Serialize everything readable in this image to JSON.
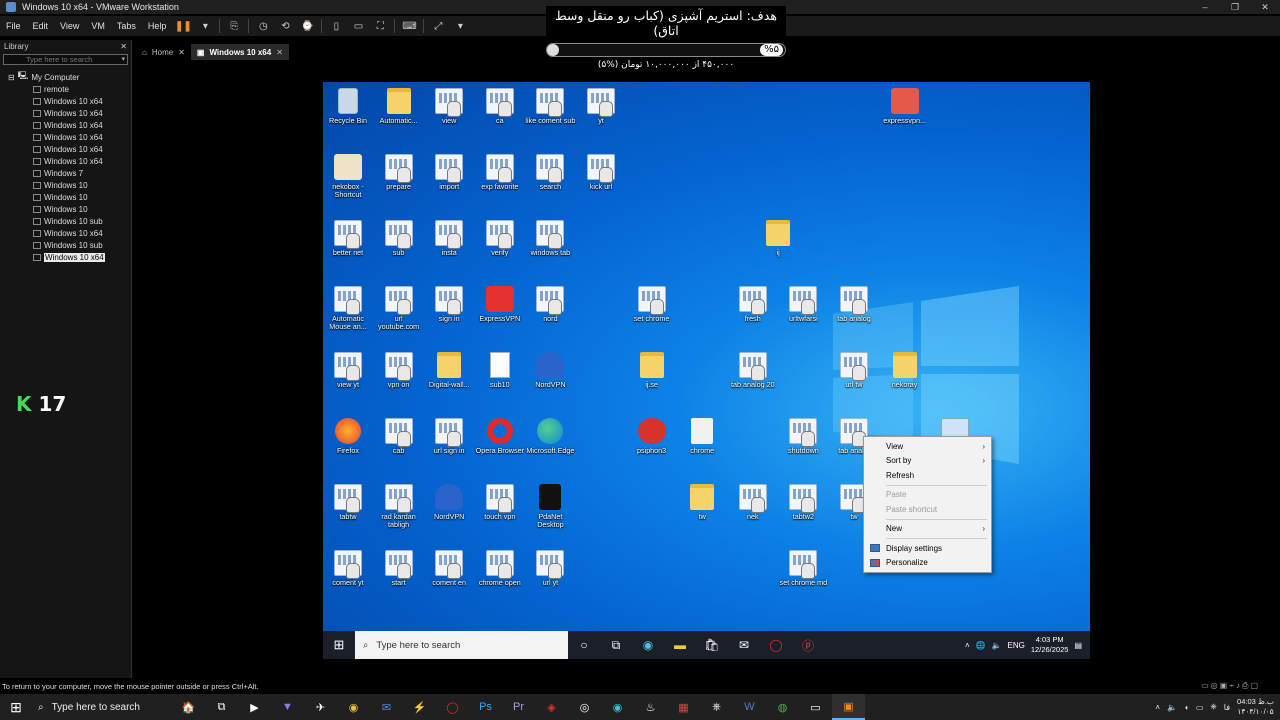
{
  "window": {
    "title": "Windows 10 x64 - VMware Workstation",
    "controls": [
      "–",
      "❐",
      "✕"
    ]
  },
  "menu": {
    "items": [
      "File",
      "Edit",
      "View",
      "VM",
      "Tabs",
      "Help"
    ]
  },
  "library": {
    "title": "Library",
    "close": "✕",
    "search_placeholder": "Type here to search",
    "root_label": "My Computer",
    "items": [
      "remote",
      "Windows 10 x64",
      "Windows 10 x64",
      "Windows 10 x64",
      "Windows 10 x64",
      "Windows 10 x64",
      "Windows 10 x64",
      "Windows 7",
      "Windows 10",
      "Windows 10",
      "Windows 10",
      "Windows 10 sub",
      "Windows 10 x64",
      "Windows 10 sub",
      "Windows 10 x64"
    ],
    "selected_index": 14
  },
  "logo_badge": {
    "letter": "K",
    "number": "17"
  },
  "tabs": [
    {
      "label": "Home",
      "close": "✕"
    },
    {
      "label": "Windows 10 x64",
      "close": "✕"
    }
  ],
  "stream_overlay": {
    "goal_text": "هدف: استریم آشپزی (کباب رو منقل وسط اتاق)",
    "progress_percent": 5,
    "progress_label": "%۵",
    "amount_text": "۴۵۰,۰۰۰ از ۱۰,۰۰۰,۰۰۰ تومان (%۵)"
  },
  "desktop_icons": [
    {
      "label": "Recycle Bin",
      "icon": "recycle-bin-icon"
    },
    {
      "label": "Automatic...",
      "icon": "folder-icon"
    },
    {
      "label": "view",
      "icon": "keyboard-mouse-icon"
    },
    {
      "label": "ca",
      "icon": "keyboard-mouse-icon"
    },
    {
      "label": "like coment sub",
      "icon": "keyboard-mouse-icon"
    },
    {
      "label": "yt",
      "icon": "keyboard-mouse-icon"
    },
    {
      "label": "expressvpn...",
      "icon": "package-icon"
    },
    {
      "label": "nekobox - Shortcut",
      "icon": "nekobox-icon"
    },
    {
      "label": "prepare",
      "icon": "keyboard-mouse-icon"
    },
    {
      "label": "import",
      "icon": "keyboard-mouse-icon"
    },
    {
      "label": "exp favorite",
      "icon": "keyboard-mouse-icon"
    },
    {
      "label": "search",
      "icon": "keyboard-mouse-icon"
    },
    {
      "label": "kick url",
      "icon": "keyboard-mouse-icon"
    },
    {
      "label": "better net",
      "icon": "keyboard-mouse-icon"
    },
    {
      "label": "sub",
      "icon": "keyboard-mouse-icon"
    },
    {
      "label": "insta",
      "icon": "keyboard-mouse-icon"
    },
    {
      "label": "verify",
      "icon": "keyboard-mouse-icon"
    },
    {
      "label": "windows tab",
      "icon": "keyboard-mouse-icon"
    },
    {
      "label": "ij",
      "icon": "folder-icon"
    },
    {
      "label": "Automatic Mouse an...",
      "icon": "keyboard-mouse-icon"
    },
    {
      "label": "url youtube.com",
      "icon": "keyboard-mouse-icon"
    },
    {
      "label": "sign in",
      "icon": "keyboard-mouse-icon"
    },
    {
      "label": "ExpressVPN",
      "icon": "expressvpn-icon"
    },
    {
      "label": "nord",
      "icon": "keyboard-mouse-icon"
    },
    {
      "label": "set chrome",
      "icon": "keyboard-mouse-icon"
    },
    {
      "label": "fresh",
      "icon": "keyboard-mouse-icon"
    },
    {
      "label": "urltwfarsi",
      "icon": "keyboard-mouse-icon"
    },
    {
      "label": "tab analog",
      "icon": "keyboard-mouse-icon"
    },
    {
      "label": "view yt",
      "icon": "keyboard-mouse-icon"
    },
    {
      "label": "vpn on",
      "icon": "keyboard-mouse-icon"
    },
    {
      "label": "Digital-wall...",
      "icon": "image-file-icon"
    },
    {
      "label": "sub10",
      "icon": "document-icon"
    },
    {
      "label": "NordVPN",
      "icon": "nordvpn-icon"
    },
    {
      "label": "ij.se",
      "icon": "image-file-icon"
    },
    {
      "label": "tab analog 20",
      "icon": "keyboard-mouse-icon"
    },
    {
      "label": "url tw",
      "icon": "keyboard-mouse-icon"
    },
    {
      "label": "nekoray",
      "icon": "folder-icon"
    },
    {
      "label": "Firefox",
      "icon": "firefox-icon"
    },
    {
      "label": "cab",
      "icon": "keyboard-mouse-icon"
    },
    {
      "label": "url sign in",
      "icon": "keyboard-mouse-icon"
    },
    {
      "label": "Opera Browser",
      "icon": "opera-icon"
    },
    {
      "label": "Microsoft Edge",
      "icon": "edge-icon"
    },
    {
      "label": "psiphon3",
      "icon": "psiphon-icon"
    },
    {
      "label": "chrome",
      "icon": "chrome-file-icon"
    },
    {
      "label": "shutdown",
      "icon": "keyboard-mouse-icon"
    },
    {
      "label": "tab anal...",
      "icon": "keyboard-mouse-icon"
    },
    {
      "label": "",
      "icon": "computer-icon"
    },
    {
      "label": "tabtw",
      "icon": "keyboard-mouse-icon"
    },
    {
      "label": "rad kardan tabligh",
      "icon": "keyboard-mouse-icon"
    },
    {
      "label": "NordVPN",
      "icon": "nordvpn-icon"
    },
    {
      "label": "touch vpn",
      "icon": "keyboard-mouse-icon"
    },
    {
      "label": "PdaNet Desktop",
      "icon": "pdanet-icon"
    },
    {
      "label": "tw",
      "icon": "folder-icon"
    },
    {
      "label": "nek",
      "icon": "keyboard-mouse-icon"
    },
    {
      "label": "tabtw2",
      "icon": "keyboard-mouse-icon"
    },
    {
      "label": "tw",
      "icon": "keyboard-mouse-icon"
    },
    {
      "label": "coment yt",
      "icon": "keyboard-mouse-icon"
    },
    {
      "label": "start",
      "icon": "keyboard-mouse-icon"
    },
    {
      "label": "coment en",
      "icon": "keyboard-mouse-icon"
    },
    {
      "label": "chrome open",
      "icon": "keyboard-mouse-icon"
    },
    {
      "label": "url yt",
      "icon": "keyboard-mouse-icon"
    },
    {
      "label": "set chrome md",
      "icon": "keyboard-mouse-icon"
    }
  ],
  "context_menu": {
    "items": [
      {
        "label": "View",
        "submenu": "›",
        "enabled": true
      },
      {
        "label": "Sort by",
        "submenu": "›",
        "enabled": true
      },
      {
        "label": "Refresh",
        "submenu": "",
        "enabled": true
      },
      {
        "label": "Paste",
        "submenu": "",
        "enabled": false
      },
      {
        "label": "Paste shortcut",
        "submenu": "",
        "enabled": false
      },
      {
        "label": "New",
        "submenu": "›",
        "enabled": true
      },
      {
        "label": "Display settings",
        "submenu": "",
        "enabled": true
      },
      {
        "label": "Personalize",
        "submenu": "",
        "enabled": true
      }
    ]
  },
  "guest_taskbar": {
    "search_placeholder": "Type here to search",
    "language": "ENG",
    "time": "4:03 PM",
    "date": "12/26/2025"
  },
  "status_bar": {
    "hint": "To return to your computer, move the mouse pointer outside or press Ctrl+Alt."
  },
  "host_taskbar": {
    "search_placeholder": "Type here to search",
    "language": "فا",
    "time": "04:03 ب.ظ",
    "date": "۱۴۰۴/۱۰/۰۵"
  },
  "colors": {
    "accent_orange": "#f28b24",
    "desktop_blue": "#0463cf",
    "k17_green": "#3fdc5b"
  }
}
